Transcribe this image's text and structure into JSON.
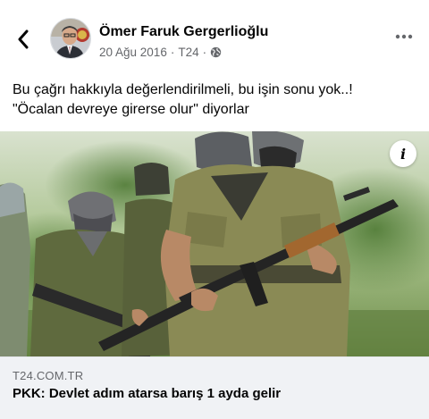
{
  "post": {
    "author": {
      "name": "Ömer Faruk Gergerlioğlu",
      "avatar_icon": "person-photo-avatar"
    },
    "meta": {
      "date": "20 Ağu 2016",
      "separator": "·",
      "source": "T24",
      "audience_icon": "globe-icon"
    },
    "text": {
      "line1": "Bu çağrı hakkıyla değerlendirilmeli, bu işin sonu yok..!",
      "line2": "\"Öcalan devreye girerse olur\" diyorlar"
    },
    "link_preview": {
      "image_icon": "news-photo-armed-militants",
      "info_label": "i",
      "domain": "T24.COM.TR",
      "title": "PKK: Devlet adım atarsa barış 1 ayda gelir"
    }
  },
  "colors": {
    "text_primary": "#050505",
    "text_secondary": "#65676b",
    "preview_background": "#f0f2f5"
  },
  "icons": {
    "back": "chevron-left-icon",
    "more": "more-dots-icon"
  }
}
